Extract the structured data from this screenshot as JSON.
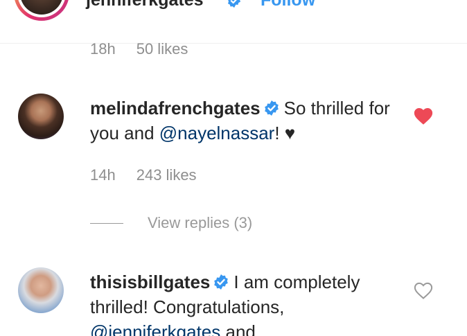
{
  "post_header": {
    "username": "jenniferkgates",
    "follow_label": "Follow"
  },
  "caption_meta": {
    "age": "18h",
    "likes": "50 likes"
  },
  "comments": [
    {
      "username": "melindafrenchgates",
      "text_before": "So thrilled for you and ",
      "mention": "@nayelnassar",
      "text_after": "! ♥",
      "age": "14h",
      "likes": "243 likes",
      "liked": true,
      "view_replies": "View replies (3)"
    },
    {
      "username": "thisisbillgates",
      "text_before": "I am completely thrilled! Congratulations, ",
      "mention": "@jenniferkgates",
      "text_after": " and",
      "liked": false
    }
  ],
  "colors": {
    "accent_blue": "#3897f0",
    "verified_blue": "#3897f0",
    "heart_red": "#ed4956",
    "mention": "#003569",
    "meta_gray": "#8e8e8e"
  },
  "icons": {
    "verified": "verified-badge-icon",
    "heart_filled": "heart-filled-icon",
    "heart_outline": "heart-outline-icon"
  }
}
